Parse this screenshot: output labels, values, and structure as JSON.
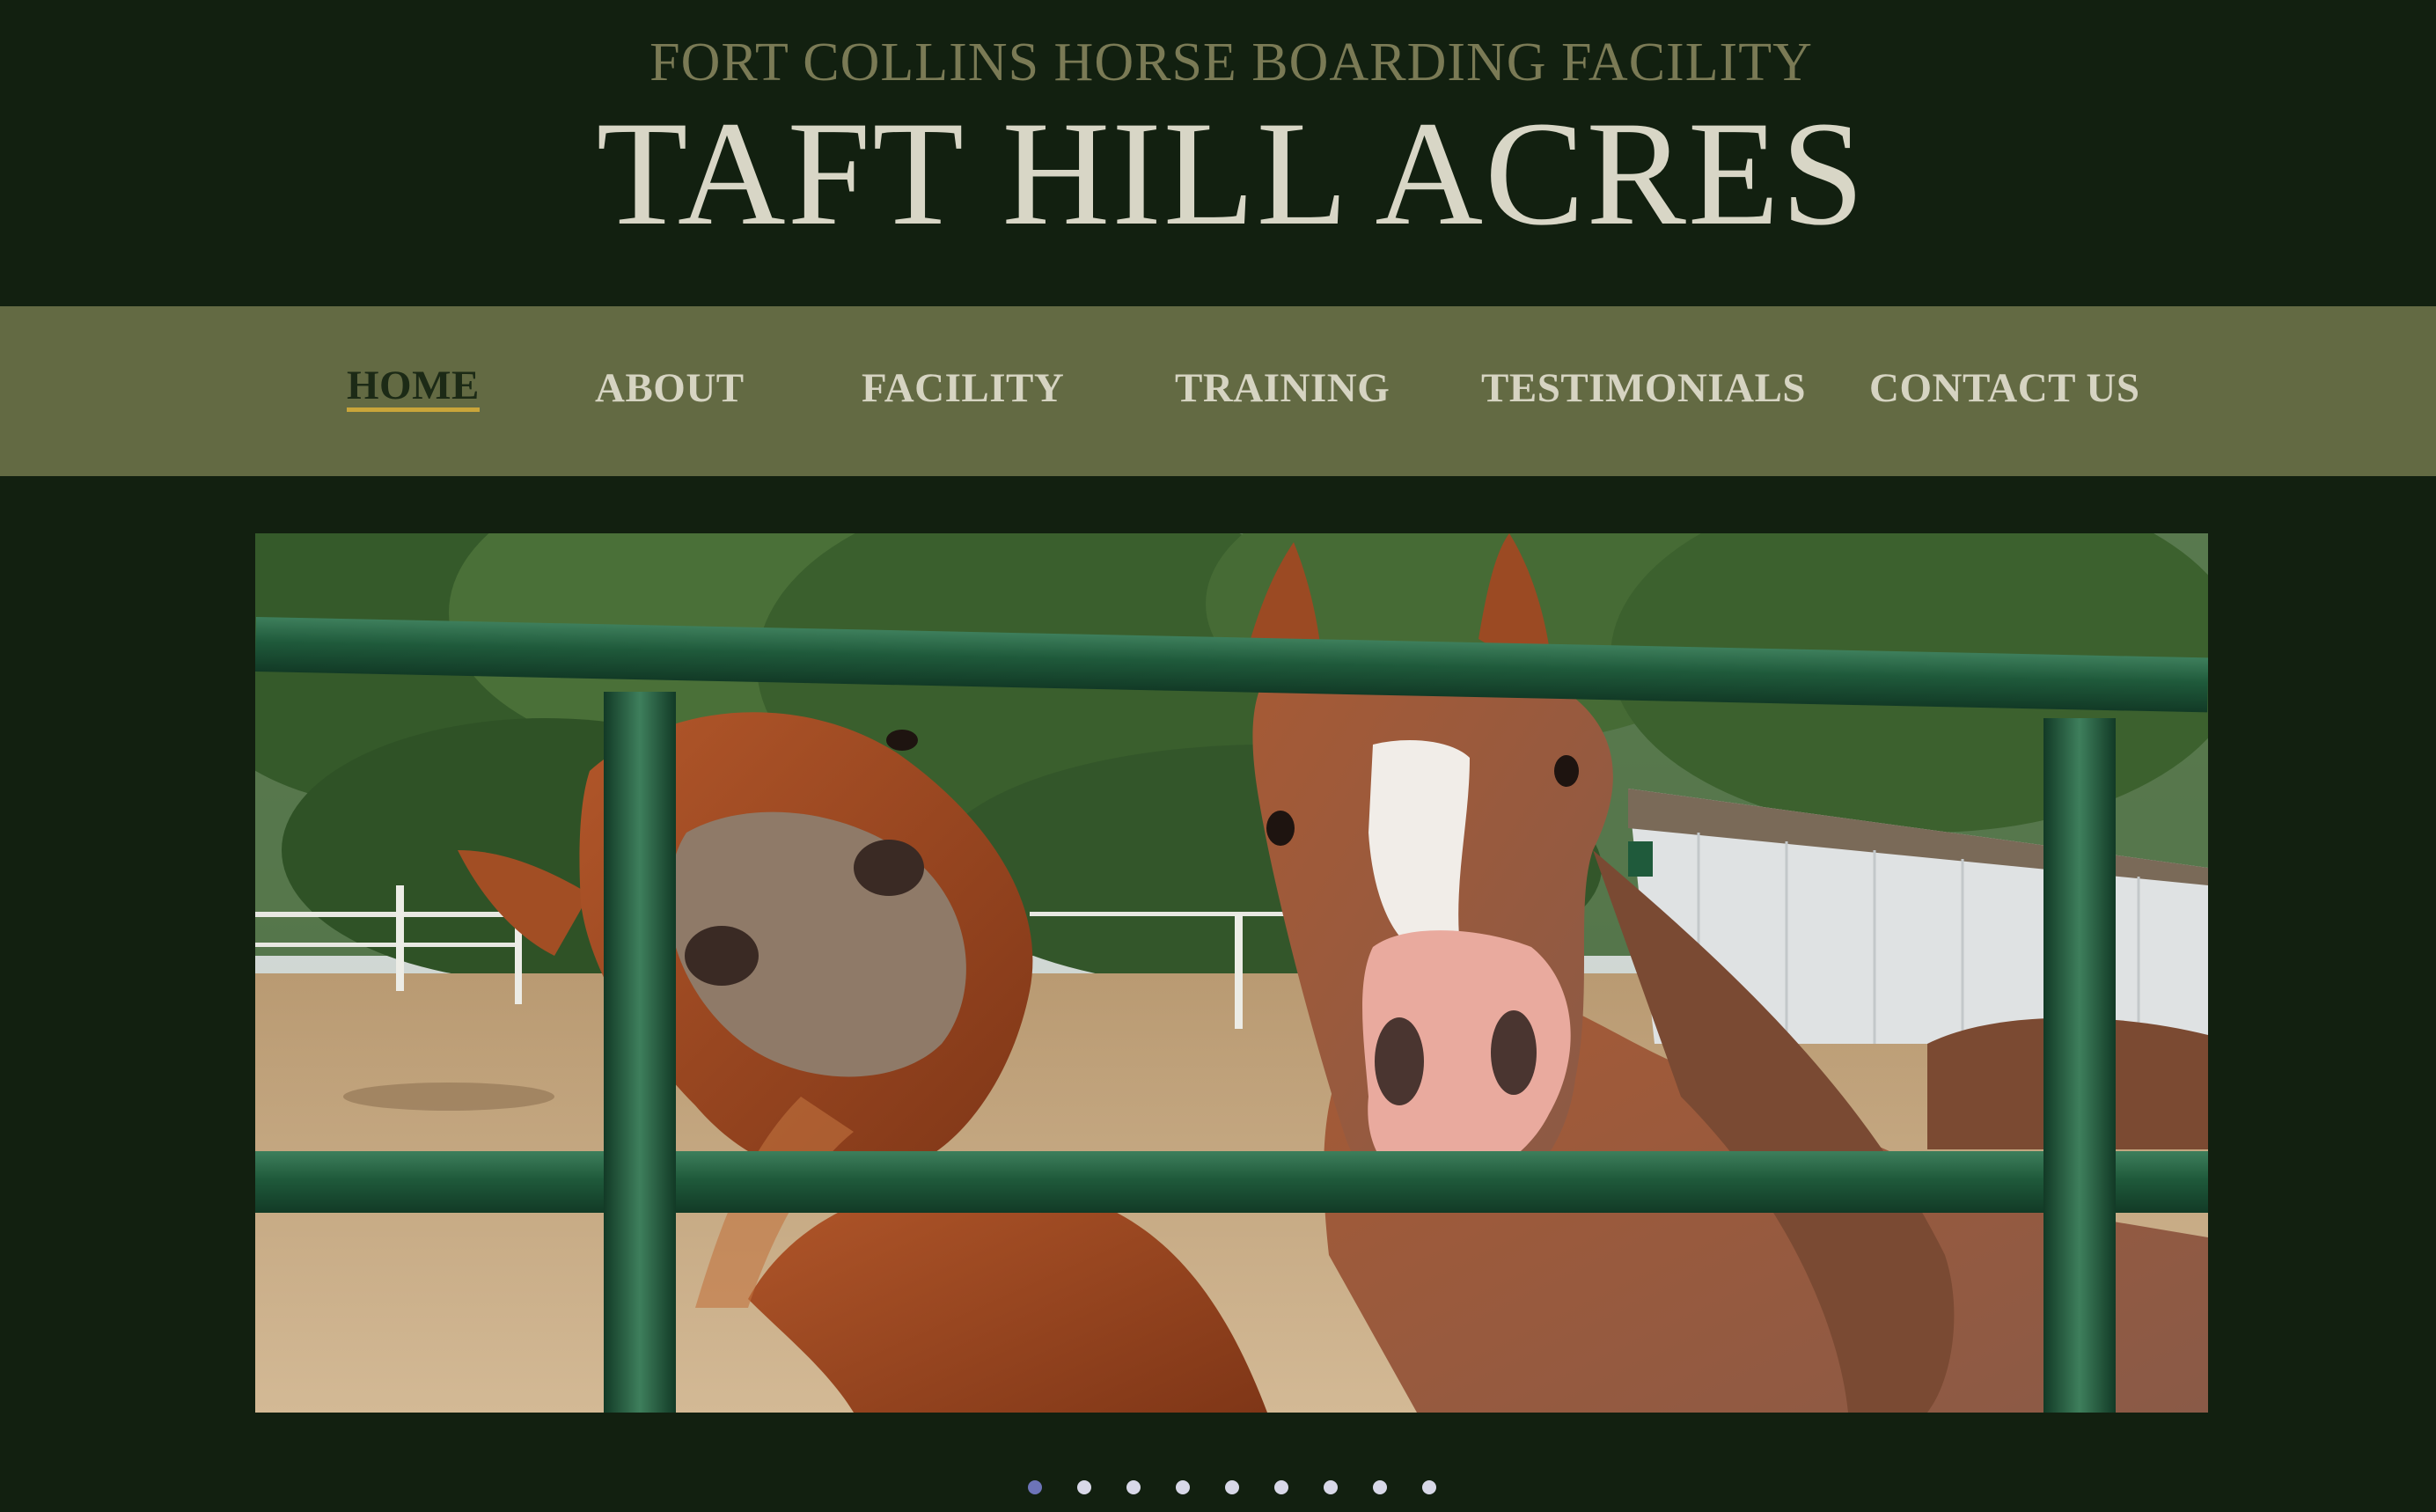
{
  "header": {
    "subtitle": "FORT COLLINS HORSE BOARDING FACILITY",
    "title": "TAFT HILL ACRES"
  },
  "nav": {
    "items": [
      {
        "label": "HOME",
        "active": true
      },
      {
        "label": "ABOUT"
      },
      {
        "label": "FACILITY"
      },
      {
        "label": "TRAINING"
      },
      {
        "label": "TESTIMONIALS"
      },
      {
        "label": "CONTACT US"
      }
    ]
  },
  "hero": {
    "image": "two-horses-over-green-fence-photo"
  },
  "slider": {
    "count": 9,
    "active_index": 0
  },
  "colors": {
    "background": "#122010",
    "nav_bar": "#636a43",
    "subtitle": "#7a7a55",
    "title": "#d8d6c6",
    "nav_text": "#d6d4c2",
    "nav_active_text": "#1c2a16",
    "nav_active_underline": "#c9a53a",
    "dot_active": "#6d74b8",
    "dot": "#d8d8e8"
  }
}
